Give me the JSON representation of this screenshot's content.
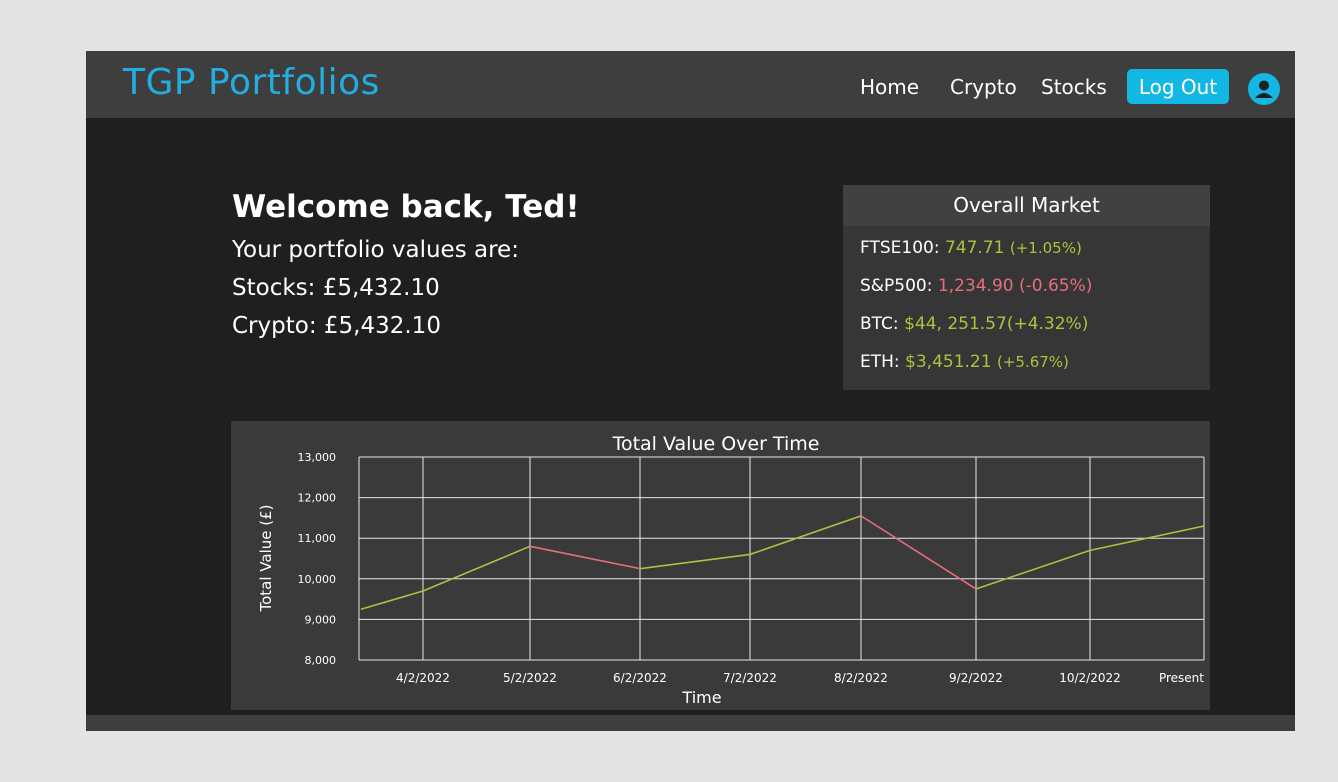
{
  "brand": "TGP Portfolios",
  "nav": {
    "home": "Home",
    "crypto": "Crypto",
    "stocks": "Stocks",
    "logout": "Log Out",
    "avatar_icon": "user-icon"
  },
  "welcome": {
    "title": "Welcome back, Ted!",
    "subtitle": "Your portfolio values are:",
    "stocks_label": "Stocks:",
    "stocks_value": "£5,432.10",
    "crypto_label": "Crypto:",
    "crypto_value": "£5,432.10"
  },
  "market": {
    "title": "Overall Market",
    "rows": [
      {
        "label": "FTSE100:",
        "price": "747.71",
        "change": "(+1.05%)",
        "trend": "up"
      },
      {
        "label": "S&P500:",
        "price": "1,234.90",
        "change": "(-0.65%)",
        "trend": "down"
      },
      {
        "label": "BTC:",
        "price": "$44, 251.57",
        "change": "(+4.32%)",
        "trend": "up"
      },
      {
        "label": "ETH:",
        "price": "$3,451.21",
        "change": "(+5.67%)",
        "trend": "up"
      }
    ]
  },
  "colors": {
    "accent": "#13b7e3",
    "brand": "#23aee0",
    "up": "#a8c53c",
    "down": "#e86d7c"
  },
  "chart_data": {
    "type": "line",
    "title": "Total Value Over Time",
    "xlabel": "Time",
    "ylabel": "Total Value (£)",
    "ylim": [
      8000,
      13000
    ],
    "yticks": [
      "13,000",
      "12,000",
      "11,000",
      "10,000",
      "9,000",
      "8,000"
    ],
    "categories": [
      "4/2/2022",
      "5/2/2022",
      "6/2/2022",
      "7/2/2022",
      "8/2/2022",
      "9/2/2022",
      "10/2/2022",
      "Present"
    ],
    "points": [
      {
        "x": "start",
        "y": 9250
      },
      {
        "x": "4/2/2022",
        "y": 9700
      },
      {
        "x": "5/2/2022",
        "y": 10800
      },
      {
        "x": "6/2/2022",
        "y": 10250
      },
      {
        "x": "7/2/2022",
        "y": 10600
      },
      {
        "x": "8/2/2022",
        "y": 11550
      },
      {
        "x": "9/2/2022",
        "y": 9750
      },
      {
        "x": "10/2/2022",
        "y": 10700
      },
      {
        "x": "Present",
        "y": 11300
      }
    ],
    "grid": true
  }
}
